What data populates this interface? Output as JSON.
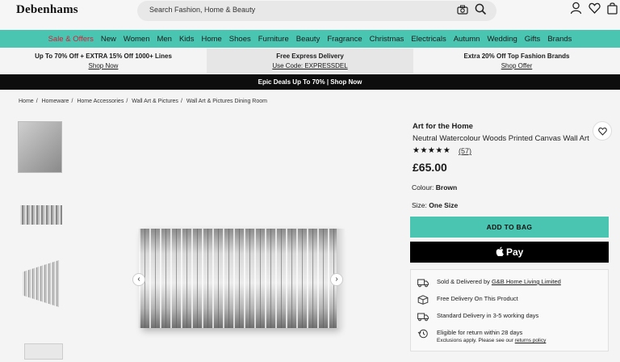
{
  "header": {
    "logo": "Debenhams",
    "search_placeholder": "Search Fashion, Home & Beauty",
    "icons": [
      "camera-icon",
      "search-icon",
      "user-icon",
      "heart-icon",
      "bag-icon"
    ]
  },
  "nav": {
    "items": [
      "Sale & Offers",
      "New",
      "Women",
      "Men",
      "Kids",
      "Home",
      "Shoes",
      "Furniture",
      "Beauty",
      "Fragrance",
      "Christmas",
      "Electricals",
      "Autumn",
      "Wedding",
      "Gifts",
      "Brands"
    ],
    "sale_color": "#d0213a",
    "bar_color": "#49c5b1"
  },
  "promos": [
    {
      "title": "Up To 70% Off + EXTRA 15% Off 1000+ Lines",
      "link": "Shop Now"
    },
    {
      "title": "Free Express Delivery",
      "link": "Use Code: EXPRESSDEL"
    },
    {
      "title": "Extra 20% Off Top Fashion Brands",
      "link": "Shop Offer"
    }
  ],
  "banner": "Epic Deals Up To 70% | Shop Now",
  "breadcrumb": [
    "Home",
    "Homeware",
    "Home Accessories",
    "Wall Art & Pictures",
    "Wall Art & Pictures Dining Room"
  ],
  "product": {
    "brand": "Art for the Home",
    "name": "Neutral Watercolour Woods Printed Canvas Wall Art",
    "stars": "★★★★★",
    "reviews": "(57)",
    "price": "£65.00",
    "colour_label": "Colour:",
    "colour_value": "Brown",
    "size_label": "Size:",
    "size_value": "One Size",
    "add_to_bag": "ADD TO BAG",
    "apple_pay": " Pay"
  },
  "delivery": {
    "sold_prefix": "Sold & Delivered by ",
    "sold_by": "G&B Home Living Limited",
    "free_delivery": "Free Delivery On This Product",
    "standard": "Standard Delivery in 3-5 working days",
    "returns": "Eligible for return within 28 days",
    "returns_sub_prefix": "Exclusions apply. Please see our ",
    "returns_link": "returns policy"
  },
  "gallery": {
    "prev": "‹",
    "next": "›"
  }
}
